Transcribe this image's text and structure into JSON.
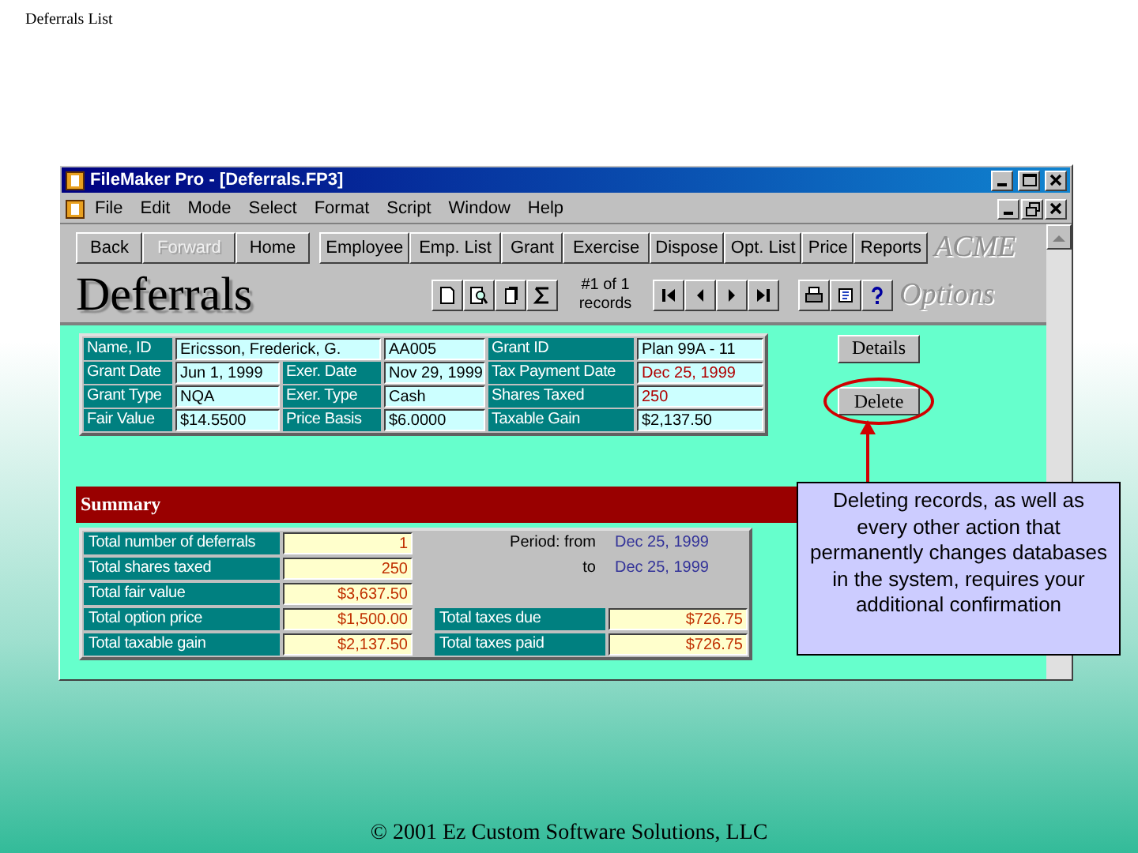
{
  "slide_title": "Deferrals List",
  "window": {
    "title": "FileMaker Pro - [Deferrals.FP3]"
  },
  "menu": [
    "File",
    "Edit",
    "Mode",
    "Select",
    "Format",
    "Script",
    "Window",
    "Help"
  ],
  "nav_buttons": [
    {
      "label": "Back",
      "disabled": false
    },
    {
      "label": "Forward",
      "disabled": true
    },
    {
      "label": "Home",
      "disabled": false
    }
  ],
  "section_buttons": [
    "Employee",
    "Emp. List",
    "Grant",
    "Exercise",
    "Dispose",
    "Opt. List",
    "Price",
    "Reports"
  ],
  "brand": "ACME",
  "layout_title": "Deferrals",
  "record_counter": [
    "#1 of 1",
    "records"
  ],
  "options_label": "Options",
  "record_fields": [
    [
      {
        "kind": "label",
        "text": "Name, ID"
      },
      {
        "kind": "wide_value",
        "text": "Ericsson, Frederick, G.",
        "alert": false
      },
      {
        "kind": "value",
        "text": "AA005",
        "alert": false
      },
      {
        "kind": "label",
        "text": "Grant ID"
      },
      {
        "kind": "value",
        "text": "Plan 99A - 11",
        "alert": false
      }
    ],
    [
      {
        "kind": "label",
        "text": "Grant Date"
      },
      {
        "kind": "value",
        "text": "Jun 1, 1999",
        "alert": false
      },
      {
        "kind": "label",
        "text": "Exer. Date"
      },
      {
        "kind": "value",
        "text": "Nov 29, 1999",
        "alert": false
      },
      {
        "kind": "label",
        "text": "Tax Payment Date"
      },
      {
        "kind": "value",
        "text": "Dec 25, 1999",
        "alert": true
      }
    ],
    [
      {
        "kind": "label",
        "text": "Grant Type"
      },
      {
        "kind": "value",
        "text": "NQA",
        "alert": false
      },
      {
        "kind": "label",
        "text": "Exer. Type"
      },
      {
        "kind": "value",
        "text": "Cash",
        "alert": false
      },
      {
        "kind": "label",
        "text": "Shares Taxed"
      },
      {
        "kind": "value",
        "text": "250",
        "alert": true
      }
    ],
    [
      {
        "kind": "label",
        "text": "Fair Value"
      },
      {
        "kind": "value",
        "text": "$14.5500",
        "alert": false
      },
      {
        "kind": "label",
        "text": "Price Basis"
      },
      {
        "kind": "value",
        "text": "$6.0000",
        "alert": false
      },
      {
        "kind": "label",
        "text": "Taxable Gain"
      },
      {
        "kind": "value",
        "text": "$2,137.50",
        "alert": false
      }
    ]
  ],
  "action_buttons": [
    {
      "label": "Details",
      "highlighted": false
    },
    {
      "label": "Delete",
      "highlighted": true
    }
  ],
  "summary": {
    "title": "Summary",
    "rows": [
      {
        "label": "Total number of deferrals",
        "value": "1",
        "side": {
          "kind": "period",
          "label": "Period: from",
          "value": "Dec 25, 1999"
        }
      },
      {
        "label": "Total shares taxed",
        "value": "250",
        "side": {
          "kind": "period",
          "label": "to",
          "value": "Dec 25, 1999"
        }
      },
      {
        "label": "Total fair value",
        "value": "$3,637.50"
      },
      {
        "label": "Total option price",
        "value": "$1,500.00",
        "side": {
          "kind": "field",
          "label": "Total taxes due",
          "value": "$726.75"
        }
      },
      {
        "label": "Total taxable gain",
        "value": "$2,137.50",
        "side": {
          "kind": "field",
          "label": "Total taxes paid",
          "value": "$726.75"
        }
      }
    ]
  },
  "callout": "Deleting records, as well as every other action that permanently changes databases in the system, requires your additional confirmation",
  "footer": "© 2001 Ez Custom Software Solutions, LLC"
}
